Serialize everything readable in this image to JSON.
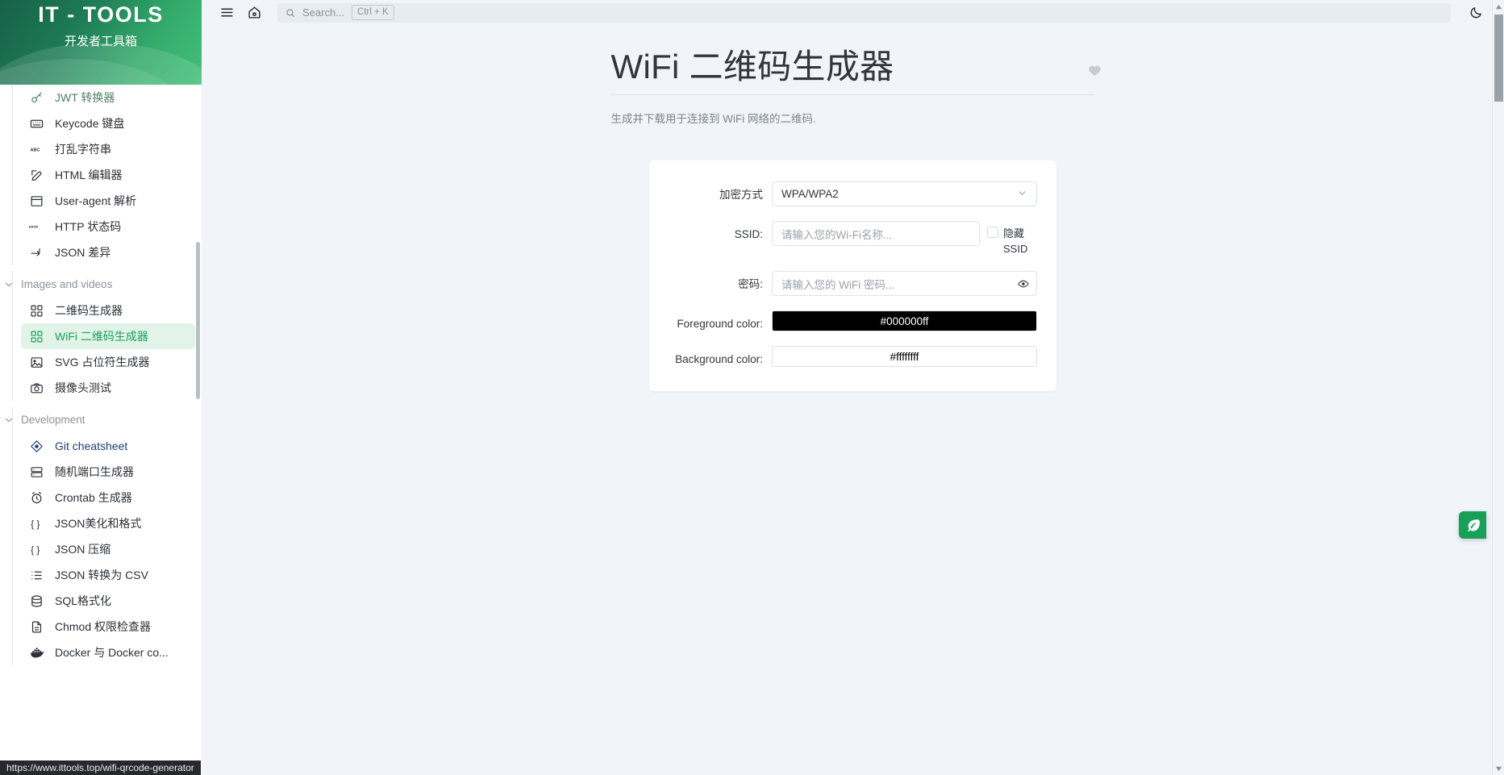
{
  "brand": {
    "title": "IT - TOOLS",
    "subtitle": "开发者工具箱"
  },
  "topbar": {
    "menu_icon": "hamburger-menu-icon",
    "home_icon": "home-icon",
    "search_placeholder": "Search...",
    "search_shortcut": "Ctrl + K",
    "theme_icon": "moon-icon"
  },
  "sidebar": {
    "top_items": [
      {
        "label": "JWT 转换器",
        "icon": "key-icon",
        "state": "faded"
      },
      {
        "label": "Keycode 键盘",
        "icon": "keyboard-icon",
        "state": "normal"
      },
      {
        "label": "打乱字符串",
        "icon": "abc-icon",
        "state": "normal"
      },
      {
        "label": "HTML 编辑器",
        "icon": "pencil-square-icon",
        "state": "normal"
      },
      {
        "label": "User-agent 解析",
        "icon": "browser-window-icon",
        "state": "normal"
      },
      {
        "label": "HTTP 状态码",
        "icon": "http-icon",
        "state": "normal"
      },
      {
        "label": "JSON 差异",
        "icon": "diff-arrow-icon",
        "state": "normal"
      }
    ],
    "groups": [
      {
        "title": "Images and videos",
        "chevron": "chevron-down-icon",
        "items": [
          {
            "label": "二维码生成器",
            "icon": "qrcode-icon",
            "state": "normal"
          },
          {
            "label": "WiFi 二维码生成器",
            "icon": "qrcode-icon",
            "state": "active"
          },
          {
            "label": "SVG 占位符生成器",
            "icon": "image-icon",
            "state": "normal"
          },
          {
            "label": "摄像头测试",
            "icon": "camera-icon",
            "state": "normal"
          }
        ]
      },
      {
        "title": "Development",
        "chevron": "chevron-down-icon",
        "items": [
          {
            "label": "Git cheatsheet",
            "icon": "git-icon",
            "state": "git"
          },
          {
            "label": "随机端口生成器",
            "icon": "server-icon",
            "state": "normal"
          },
          {
            "label": "Crontab 生成器",
            "icon": "alarm-clock-icon",
            "state": "normal"
          },
          {
            "label": "JSON美化和格式",
            "icon": "braces-icon",
            "state": "normal"
          },
          {
            "label": "JSON 压缩",
            "icon": "braces-icon",
            "state": "normal"
          },
          {
            "label": "JSON 转换为 CSV",
            "icon": "list-icon",
            "state": "normal"
          },
          {
            "label": "SQL格式化",
            "icon": "database-icon",
            "state": "normal"
          },
          {
            "label": "Chmod 权限检查器",
            "icon": "file-text-icon",
            "state": "normal"
          },
          {
            "label": "Docker 与 Docker co...",
            "icon": "docker-whale-icon",
            "state": "normal"
          }
        ]
      }
    ]
  },
  "page": {
    "title": "WiFi 二维码生成器",
    "subtitle": "生成并下载用于连接到 WiFi 网络的二维码.",
    "favorite_icon": "heart-icon"
  },
  "form": {
    "encryption": {
      "label": "加密方式",
      "value": "WPA/WPA2",
      "chevron": "chevron-down-icon"
    },
    "ssid": {
      "label": "SSID:",
      "value": "",
      "placeholder": "请输入您的Wi-Fi名称...",
      "hidden_checkbox_label": "隐藏 SSID",
      "hidden_checked": false
    },
    "password": {
      "label": "密码:",
      "value": "",
      "placeholder": "请输入您的 WiFi 密码...",
      "reveal_icon": "eye-icon"
    },
    "foreground": {
      "label": "Foreground color:",
      "value": "#000000ff",
      "swatch": "#000000",
      "text_color": "#ffffff"
    },
    "background": {
      "label": "Background color:",
      "value": "#ffffffff",
      "swatch": "#ffffff",
      "text_color": "#000000"
    }
  },
  "fab": {
    "icon": "leaf-icon"
  },
  "status_url": "https://www.ittools.top/wifi-qrcode-generator"
}
